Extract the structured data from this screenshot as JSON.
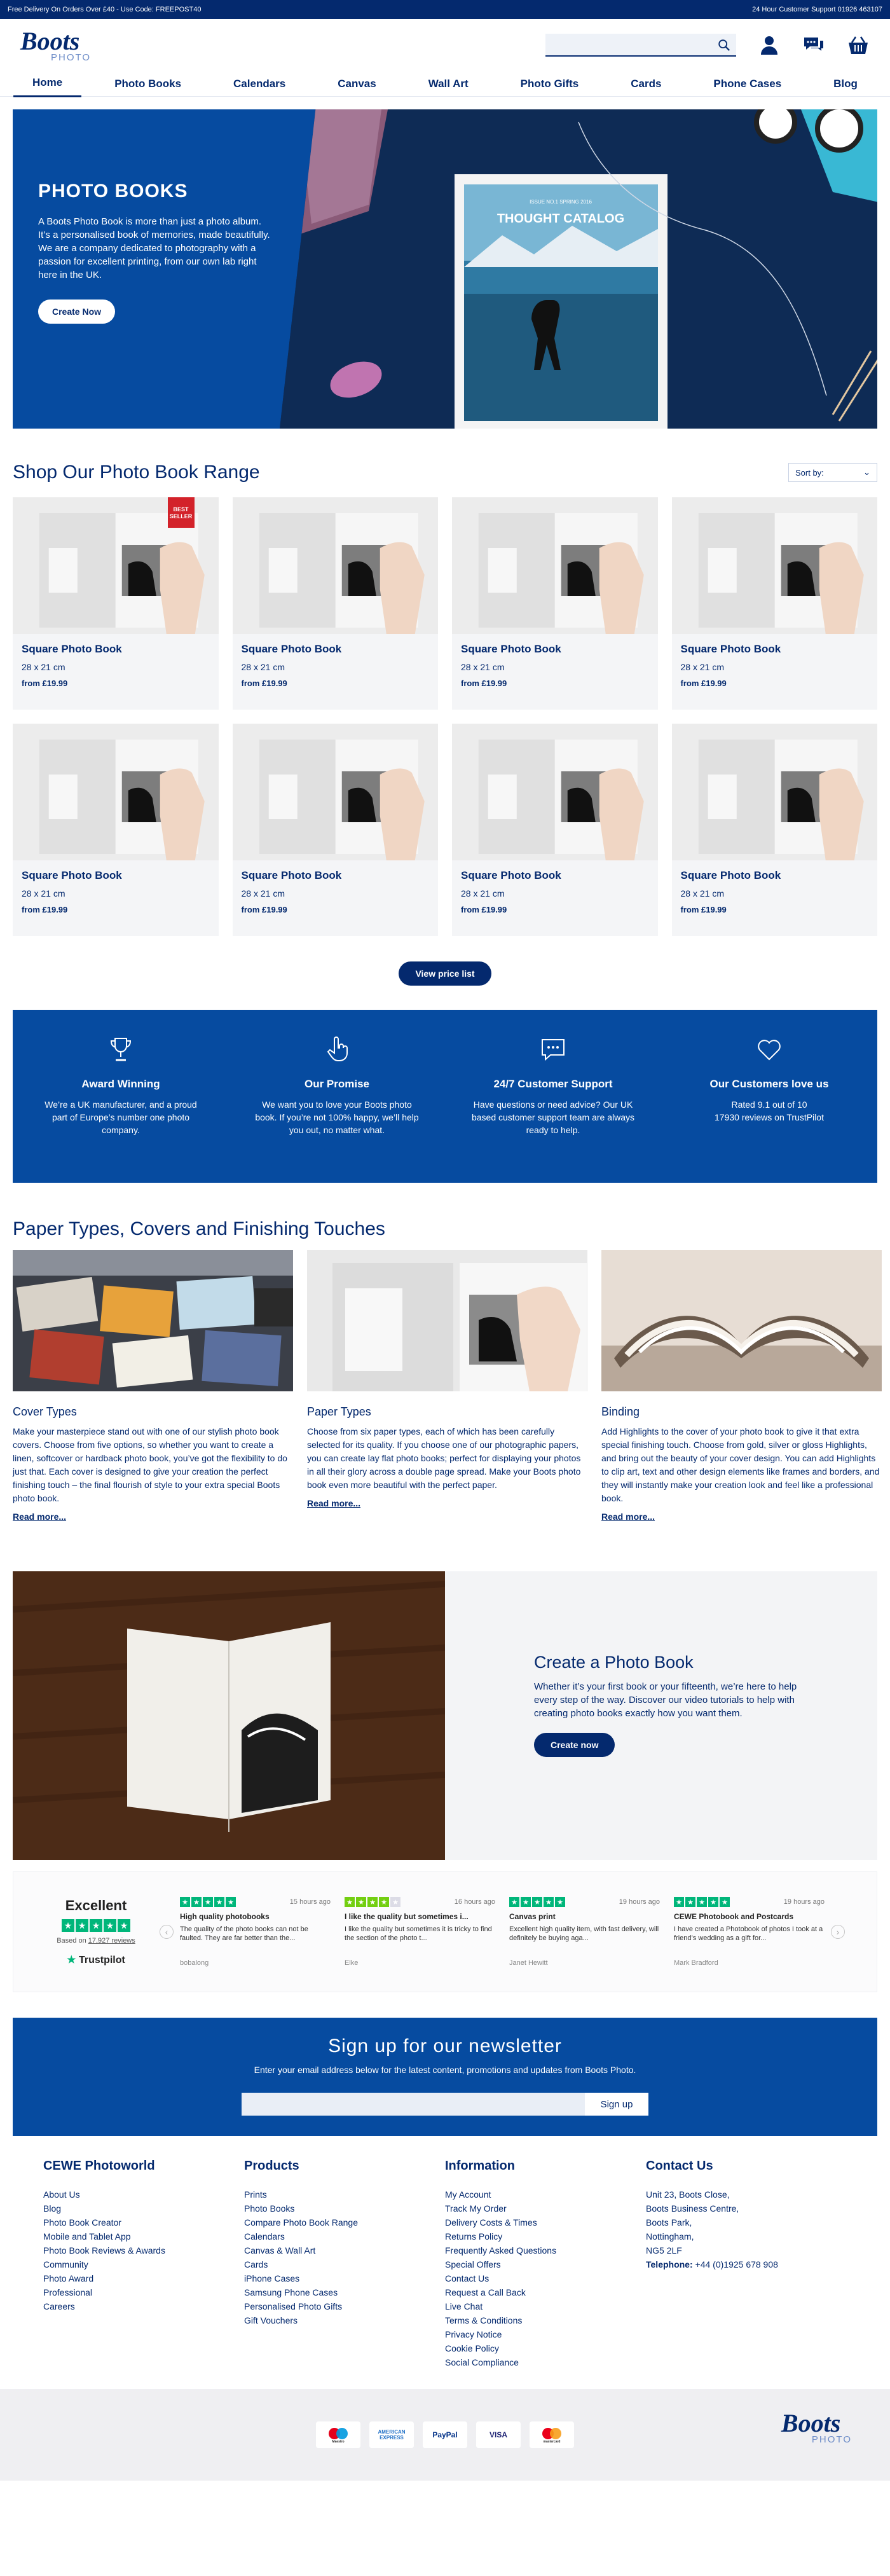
{
  "topbar": {
    "left": "Free Delivery On Orders Over £40 - Use Code: FREEPOST40",
    "right": "24 Hour Customer Support 01926 463107"
  },
  "logo": {
    "brand": "Boots",
    "sub": "PHOTO"
  },
  "search": {
    "placeholder": ""
  },
  "nav": [
    {
      "label": "Home"
    },
    {
      "label": "Photo Books"
    },
    {
      "label": "Calendars"
    },
    {
      "label": "Canvas"
    },
    {
      "label": "Wall Art"
    },
    {
      "label": "Photo Gifts"
    },
    {
      "label": "Cards"
    },
    {
      "label": "Phone Cases"
    },
    {
      "label": "Blog"
    }
  ],
  "hero": {
    "title": "PHOTO BOOKS",
    "text": "A Boots Photo Book is more than just a photo album. It’s a personalised book of memories, made beautifully. We are a company dedicated to photography with a passion for excellent printing, from our own lab right here in the UK.",
    "button": "Create Now",
    "book_title": "THOUGHT CATALOG",
    "book_small": "ISSUE NO.1   SPRING 2016"
  },
  "range": {
    "title": "Shop Our Photo Book Range",
    "sort": "Sort by:",
    "badge": "BEST SELLER",
    "products": [
      {
        "name": "Square Photo Book",
        "size": "28 x 21 cm",
        "price": "from £19.99"
      },
      {
        "name": "Square Photo Book",
        "size": "28 x 21 cm",
        "price": "from £19.99"
      },
      {
        "name": "Square Photo Book",
        "size": "28 x 21 cm",
        "price": "from £19.99"
      },
      {
        "name": "Square Photo Book",
        "size": "28 x 21 cm",
        "price": "from £19.99"
      },
      {
        "name": "Square Photo Book",
        "size": "28 x 21 cm",
        "price": "from £19.99"
      },
      {
        "name": "Square Photo Book",
        "size": "28 x 21 cm",
        "price": "from £19.99"
      },
      {
        "name": "Square Photo Book",
        "size": "28 x 21 cm",
        "price": "from £19.99"
      },
      {
        "name": "Square Photo Book",
        "size": "28 x 21 cm",
        "price": "from £19.99"
      }
    ],
    "view_button": "View price list"
  },
  "usp": [
    {
      "icon": "trophy-icon",
      "title": "Award Winning",
      "text": "We’re a UK manufacturer, and a proud part of Europe’s number one photo company."
    },
    {
      "icon": "hand-icon",
      "title": "Our Promise",
      "text": "We want you to love your Boots photo book. If you’re not 100% happy, we’ll help you out, no matter what."
    },
    {
      "icon": "chat-icon",
      "title": "24/7 Customer Support",
      "text": "Have questions or need advice? Our UK based customer support team are always ready to help."
    },
    {
      "icon": "heart-icon",
      "title": "Our Customers love us",
      "text": "Rated 9.1 out of 10\n17930 reviews on TrustPilot"
    }
  ],
  "papers": {
    "title": "Paper Types, Covers and Finishing Touches",
    "items": [
      {
        "title": "Cover Types",
        "text": "Make your masterpiece stand out with one of our stylish photo book covers. Choose from five options, so whether you want to create a linen, softcover or hardback photo book, you’ve got the flexibility to do just that. Each cover is designed to give your creation the perfect finishing touch – the final flourish of style to your extra special Boots photo book.",
        "more": "Read more..."
      },
      {
        "title": "Paper Types",
        "text": "Choose from six paper types, each of which has been carefully selected for its quality. If you choose one of our photographic papers, you can create lay flat photo books; perfect for displaying your photos in all their glory across a double page spread. Make your Boots photo book even more beautiful with the perfect paper.",
        "more": "Read more..."
      },
      {
        "title": "Binding",
        "text": "Add Highlights to the cover of your photo book to give it that extra special finishing touch. Choose from gold, silver or gloss Highlights, and bring out the beauty of your cover design. You can add Highlights to clip art, text and other design elements like frames and borders, and they will instantly make your creation look and feel like a professional book.",
        "more": "Read more..."
      }
    ]
  },
  "create": {
    "title": "Create a Photo Book",
    "text": "Whether it’s your first book or your fifteenth, we’re here to help every step of the way. Discover our video tutorials to help with creating photo books exactly how you want them.",
    "button": "Create now"
  },
  "trustpilot": {
    "rating": "Excellent",
    "based_prefix": "Based on ",
    "based_count": "17,927 reviews",
    "brand": "Trustpilot",
    "reviews": [
      {
        "time": "15 hours ago",
        "title": "High quality photobooks",
        "text": "The quality of the photo books can not be faulted. They are far better than the...",
        "author": "bobalong",
        "stars": 5
      },
      {
        "time": "16 hours ago",
        "title": "I like the quality but sometimes i...",
        "text": "I like the quality but sometimes it is tricky to find the section of the photo t...",
        "author": "Elke",
        "stars": 4
      },
      {
        "time": "19 hours ago",
        "title": "Canvas print",
        "text": "Excellent high quality item, with fast delivery, will definitely be buying aga...",
        "author": "Janet Hewitt",
        "stars": 5
      },
      {
        "time": "19 hours ago",
        "title": "CEWE Photobook and Postcards",
        "text": "I have created a Photobook of photos I took at a friend’s wedding as a gift for...",
        "author": "Mark Bradford",
        "stars": 5
      }
    ]
  },
  "newsletter": {
    "title": "Sign up for our newsletter",
    "text": "Enter your email address below for the latest content, promotions and updates from Boots Photo.",
    "placeholder": "",
    "button": "Sign up"
  },
  "footer": [
    {
      "title": "CEWE Photoworld",
      "links": [
        "About Us",
        "Blog",
        "Photo Book Creator",
        "Mobile and Tablet App",
        "Photo Book Reviews & Awards",
        "Community",
        "Photo Award",
        "Professional",
        "Careers"
      ]
    },
    {
      "title": "Products",
      "links": [
        "Prints",
        "Photo Books",
        "Compare Photo Book Range",
        "Calendars",
        "Canvas & Wall Art",
        "Cards",
        "iPhone Cases",
        "Samsung Phone Cases",
        "Personalised Photo Gifts",
        "Gift Vouchers"
      ]
    },
    {
      "title": "Information",
      "links": [
        "My Account",
        "Track My Order",
        "Delivery Costs & Times",
        "Returns Policy",
        "Frequently Asked Questions",
        "Special Offers",
        "Contact Us",
        "Request a Call Back",
        "Live Chat",
        "Terms & Conditions",
        "Privacy Notice",
        "Cookie Policy",
        "Social Compliance"
      ]
    },
    {
      "title": "Contact Us",
      "lines": [
        "Unit 23, Boots Close,",
        "Boots Business Centre,",
        "Boots Park,",
        "Nottingham,",
        "NG5 2LF"
      ],
      "tel_label": "Telephone:",
      "tel": "+44 (0)1925 678 908"
    }
  ],
  "payments": [
    "Maestro",
    "AMERICAN EXPRESS",
    "PayPal",
    "VISA",
    "mastercard"
  ]
}
